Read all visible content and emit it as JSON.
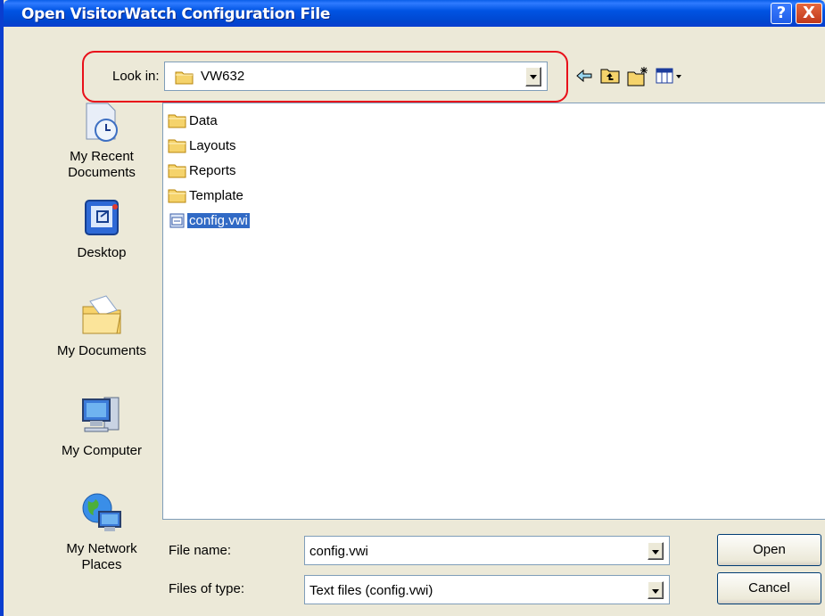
{
  "dialog": {
    "title": "Open VisitorWatch Configuration File",
    "help_glyph": "?",
    "close_glyph": "X"
  },
  "lookin": {
    "label": "Look in:",
    "value": "VW632"
  },
  "toolbar": {
    "icons": [
      "back-arrow-icon",
      "up-one-level-icon",
      "create-new-folder-icon",
      "view-menu-icon"
    ]
  },
  "places": [
    {
      "line1": "My Recent",
      "line2": "Documents",
      "icon": "recent-documents-icon"
    },
    {
      "line1": "Desktop",
      "line2": "",
      "icon": "desktop-icon"
    },
    {
      "line1": "My Documents",
      "line2": "",
      "icon": "my-documents-icon"
    },
    {
      "line1": "My Computer",
      "line2": "",
      "icon": "my-computer-icon"
    },
    {
      "line1": "My Network",
      "line2": "Places",
      "icon": "network-places-icon"
    }
  ],
  "files": [
    {
      "name": "Data",
      "type": "folder",
      "selected": false
    },
    {
      "name": "Layouts",
      "type": "folder",
      "selected": false
    },
    {
      "name": "Reports",
      "type": "folder",
      "selected": false
    },
    {
      "name": "Template",
      "type": "folder",
      "selected": false
    },
    {
      "name": "config.vwi",
      "type": "file",
      "selected": true
    }
  ],
  "file_name": {
    "label": "File name:",
    "value": "config.vwi"
  },
  "file_type": {
    "label": "Files of type:",
    "value": "Text files (config.vwi)"
  },
  "buttons": {
    "open": "Open",
    "cancel": "Cancel"
  },
  "colors": {
    "title_bar": "#0054e3",
    "dialog_bg": "#ece9d8",
    "selection": "#316ac5",
    "highlight_ring": "#e8101a",
    "folder": "#f5d36b"
  }
}
